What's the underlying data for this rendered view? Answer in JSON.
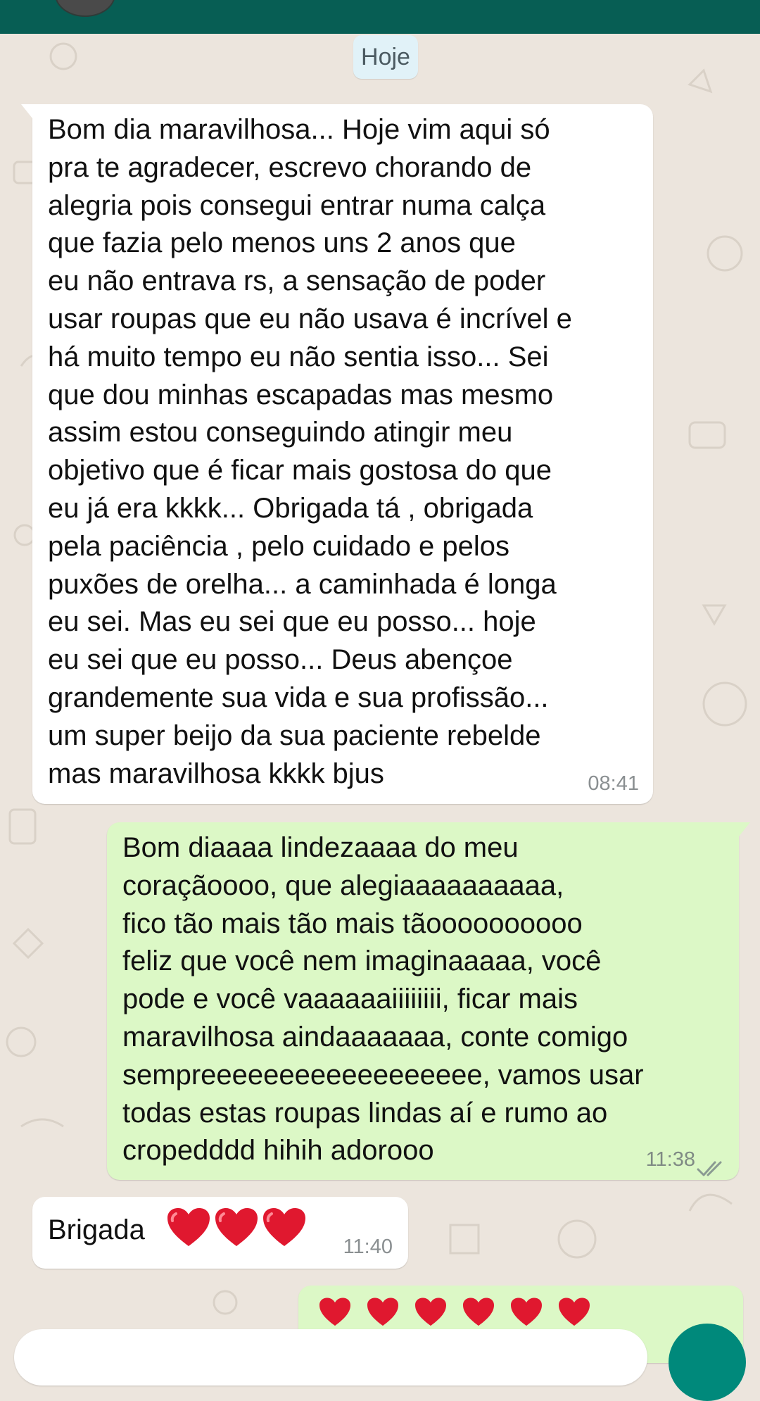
{
  "colors": {
    "header": "#075e54",
    "chat_background": "#ece5dd",
    "incoming_bubble": "#ffffff",
    "outgoing_bubble": "#dcf8c6",
    "date_chip": "#e1f2f8",
    "timestamp": "#8a8f91",
    "heart": "#e0182f",
    "send_button": "#00897b"
  },
  "date_divider": "Hoje",
  "messages": [
    {
      "direction": "incoming",
      "text": "Bom dia maravilhosa... Hoje vim aqui só\npra te agradecer, escrevo chorando de\nalegria pois consegui entrar numa calça\nque fazia pelo menos uns 2 anos que\neu não entrava rs, a sensação de poder\nusar roupas que eu não usava é incrível e\nhá muito tempo eu não sentia isso... Sei\nque dou minhas escapadas mas mesmo\nassim estou conseguindo atingir meu\nobjetivo que é ficar mais gostosa do que\neu já era kkkk... Obrigada tá , obrigada\npela paciência , pelo cuidado e pelos\npuxões de orelha... a caminhada é longa\neu sei. Mas eu sei que eu posso... hoje\neu sei que eu posso... Deus abençoe\ngrandemente sua vida e sua profissão...\num super beijo da sua paciente rebelde\nmas maravilhosa kkkk bjus",
      "time": "08:41"
    },
    {
      "direction": "outgoing",
      "text": "Bom diaaaa lindezaaaa do meu\ncoraçãoooo, que alegiaaaaaaaaaa,\nfico tão mais tão mais tãoooooooooo\nfeliz que você nem imaginaaaaa, você\npode e você vaaaaaaiiiiiiii, ficar mais\nmaravilhosa aindaaaaaaa, conte comigo\nsempreeeeeeeeeeeeeeeeee, vamos usar\ntodas estas roupas lindas aí e rumo ao\ncropedddd hihih adorooo",
      "time": "11:38",
      "status_icon": "double-check-icon"
    },
    {
      "direction": "incoming",
      "text": "Brigada",
      "emoji": "heart-icon",
      "emoji_count": 3,
      "time": "11:40"
    },
    {
      "direction": "outgoing",
      "emoji": "heart-icon",
      "emoji_count": 6
    }
  ]
}
